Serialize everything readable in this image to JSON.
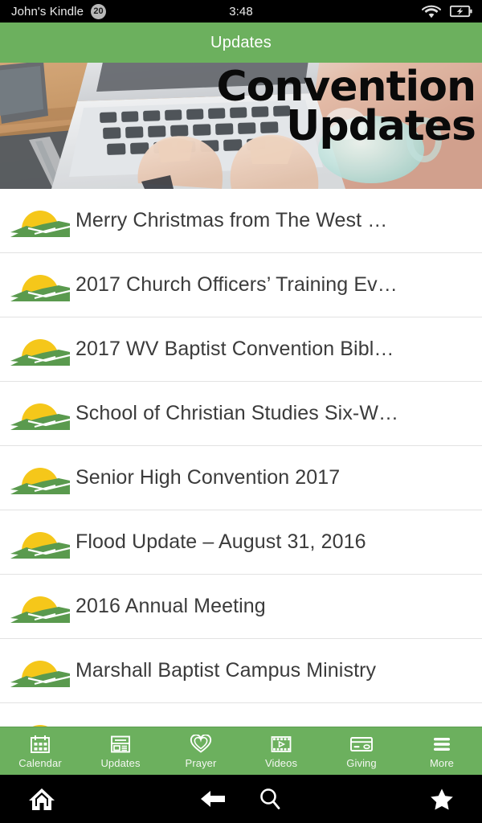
{
  "status_bar": {
    "device_name": "John's Kindle",
    "notification_count": "20",
    "time": "3:48",
    "icons": [
      "wifi-icon",
      "battery-charging-icon"
    ]
  },
  "app_header": {
    "title": "Updates",
    "accent_color": "#6cb05e"
  },
  "hero": {
    "line1": "Convention",
    "line2": "Updates",
    "alt": "Hands typing on a laptop at a wooden desk"
  },
  "list": {
    "icon_name": "sunrise-over-hills-logo",
    "items": [
      {
        "title": "Merry Christmas from The West …"
      },
      {
        "title": "2017 Church Officers’ Training Ev…"
      },
      {
        "title": "2017 WV Baptist Convention Bibl…"
      },
      {
        "title": "School of Christian Studies Six-W…"
      },
      {
        "title": "Senior High Convention 2017"
      },
      {
        "title": "Flood Update – August 31, 2016"
      },
      {
        "title": "2016 Annual Meeting"
      },
      {
        "title": "Marshall Baptist Campus Ministry"
      },
      {
        "title": ""
      }
    ]
  },
  "tab_bar": {
    "background_color": "#6cb05e",
    "active_tab": "Updates",
    "tabs": [
      {
        "label": "Calendar",
        "icon": "calendar-icon"
      },
      {
        "label": "Updates",
        "icon": "newspaper-icon"
      },
      {
        "label": "Prayer",
        "icon": "double-heart-icon"
      },
      {
        "label": "Videos",
        "icon": "film-play-icon"
      },
      {
        "label": "Giving",
        "icon": "credit-card-icon"
      },
      {
        "label": "More",
        "icon": "stacked-lines-icon"
      }
    ]
  },
  "nav_bar": {
    "buttons": [
      {
        "name": "home",
        "icon": "home-icon"
      },
      {
        "name": "back",
        "icon": "back-arrow-icon"
      },
      {
        "name": "search",
        "icon": "search-icon"
      },
      {
        "name": "favorites",
        "icon": "star-icon"
      }
    ]
  },
  "colors": {
    "green": "#6cb05e",
    "sun_yellow": "#f5c71a",
    "hill_green": "#5a9a4e",
    "divider": "#e2e2e2",
    "list_text": "#3b3b3b"
  }
}
